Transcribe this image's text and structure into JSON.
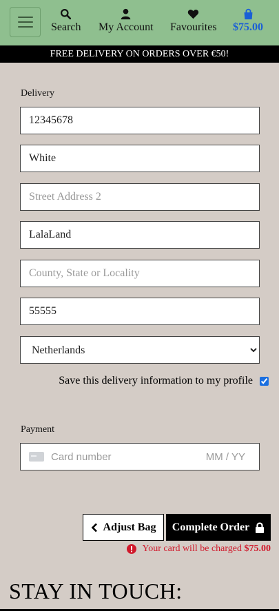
{
  "nav": {
    "search_label": "Search",
    "account_label": "My Account",
    "favourites_label": "Favourites",
    "bag_total": "$75.00"
  },
  "banner": {
    "text": "FREE DELIVERY ON ORDERS OVER €50!"
  },
  "delivery": {
    "section_label": "Delivery",
    "phone": "12345678",
    "address_line1": "White",
    "address_line2_placeholder": "Street Address 2",
    "city": "LalaLand",
    "region_placeholder": "County, State or Locality",
    "postcode": "55555",
    "country": "Netherlands",
    "save_label": "Save this delivery information to my profile"
  },
  "payment": {
    "section_label": "Payment",
    "card_placeholder": "Card number",
    "expiry_placeholder": "MM / YY"
  },
  "actions": {
    "adjust_label": "Adjust Bag",
    "complete_label": "Complete Order"
  },
  "charge": {
    "text": "Your card will be charged",
    "amount": "$75.00"
  },
  "footer": {
    "heading": "STAY IN TOUCH:"
  },
  "colors": {
    "nav_bg": "#8fbf8f",
    "accent": "#1a5fd6",
    "error": "#d0192b"
  }
}
